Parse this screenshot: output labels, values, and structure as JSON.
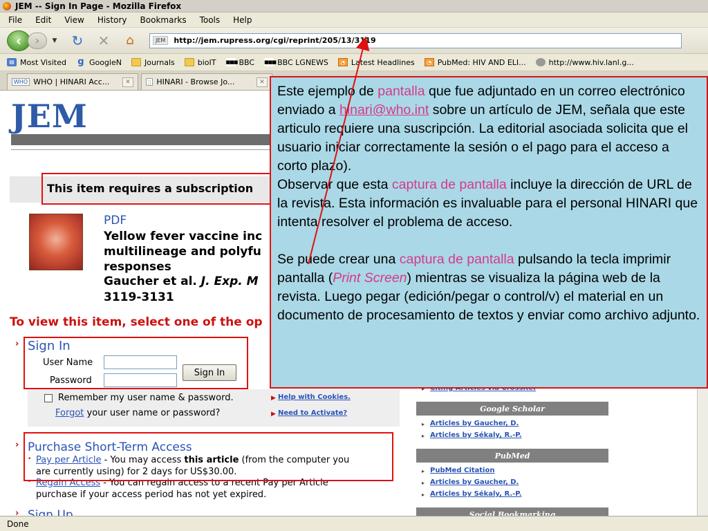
{
  "window": {
    "title": "JEM -- Sign In Page - Mozilla Firefox"
  },
  "menu": [
    "File",
    "Edit",
    "View",
    "History",
    "Bookmarks",
    "Tools",
    "Help"
  ],
  "address": {
    "favicon_text": "JEM",
    "url": "http://jem.rupress.org/cgi/reprint/205/13/3119"
  },
  "bookmarks": [
    {
      "label": "Most Visited",
      "icon": "most-visited-icon"
    },
    {
      "label": "GoogleN",
      "icon": "google-icon"
    },
    {
      "label": "Journals",
      "icon": "folder-icon"
    },
    {
      "label": "bioIT",
      "icon": "folder-icon"
    },
    {
      "label": "BBC",
      "icon": "bbc-icon"
    },
    {
      "label": "BBC LGNEWS",
      "icon": "bbc-icon"
    },
    {
      "label": "Latest Headlines",
      "icon": "rss-icon"
    },
    {
      "label": "PubMed: HIV AND ELI...",
      "icon": "rss-icon"
    },
    {
      "label": "http://www.hiv.lanl.g...",
      "icon": "globe-icon"
    }
  ],
  "tabs": [
    {
      "label": "WHO | HINARI Acc...",
      "icon_text": "WHO"
    },
    {
      "label": "HINARI - Browse Jo...",
      "icon_text": ""
    }
  ],
  "status": "Done",
  "page": {
    "logo": "JEM",
    "subscription_text": "This item requires a subscription",
    "pdf_label": "PDF",
    "article_title": "Yellow fever vaccine inc multilineage and polyfu responses",
    "authors": "Gaucher et al.",
    "journal": "J. Exp. M",
    "pages": "3119-3131",
    "to_view": "To view this item, select one of the op",
    "signin": {
      "heading": "Sign In",
      "user_label": "User Name",
      "password_label": "Password",
      "button": "Sign In",
      "remember": "Remember my user name & password.",
      "forgot_link": "Forgot",
      "forgot_rest": "your user name or password?",
      "help_cookies": "Help with Cookies.",
      "need_activate": "Need to Activate?"
    },
    "purchase": {
      "heading": "Purchase Short-Term Access",
      "ppa_link": "Pay per Article",
      "ppa_text1": " - You may access ",
      "ppa_bold": "this article",
      "ppa_text2": " (from the computer you",
      "ppa_line2": "are currently using) for 2 days for US$30.00.",
      "regain_link": "Regain Access",
      "regain_text": " - You can regain access to a recent Pay per Article",
      "regain_line2": "purchase if your access period has not yet expired."
    },
    "signup_bottom": "Sign Up",
    "sidebar": {
      "citing_link": "Citing Articles via CrossRef",
      "google_scholar": "Google Scholar",
      "gs_links": [
        "Articles by Gaucher, D.",
        "Articles by Sékaly, R.-P."
      ],
      "pubmed": "PubMed",
      "pm_links": [
        "PubMed Citation",
        "Articles by Gaucher, D.",
        "Articles by Sékaly, R.-P."
      ],
      "social": "Social Bookmarking"
    }
  },
  "callout": {
    "p1_a": "Este ejemplo de ",
    "p1_hl1": "pantalla",
    "p1_b": " que fue adjuntado en un correo electrónico enviado a ",
    "p1_mail": "hinari@who.int",
    "p1_c": "  sobre un artículo de JEM, señala que este articulo requiere una suscripción. La editorial asociada solicita que el usuario iniciar correctamente la sesión o el pago para el acceso a corto plazo).",
    "p2_a": "Observar que esta ",
    "p2_hl": "captura de pantalla",
    "p2_b": " incluye la dirección de URL de la revista. Esta información es invaluable para el personal HINARI que intenta resolver el problema de acceso.",
    "p3_a": "Se puede crear una ",
    "p3_hl": "captura de pantalla",
    "p3_b": " pulsando la tecla imprimir pantalla (",
    "p3_key": "Print Screen",
    "p3_c": ") mientras se visualiza la página web de la revista. Luego pegar (edición/pegar o control/v) el material en un documento de procesamiento de textos y enviar como archivo adjunto."
  },
  "colors": {
    "highlight_red": "#e01010",
    "callout_bg": "#aad8e6",
    "callout_accent": "#d63a8a",
    "link_blue": "#2a53b5"
  }
}
